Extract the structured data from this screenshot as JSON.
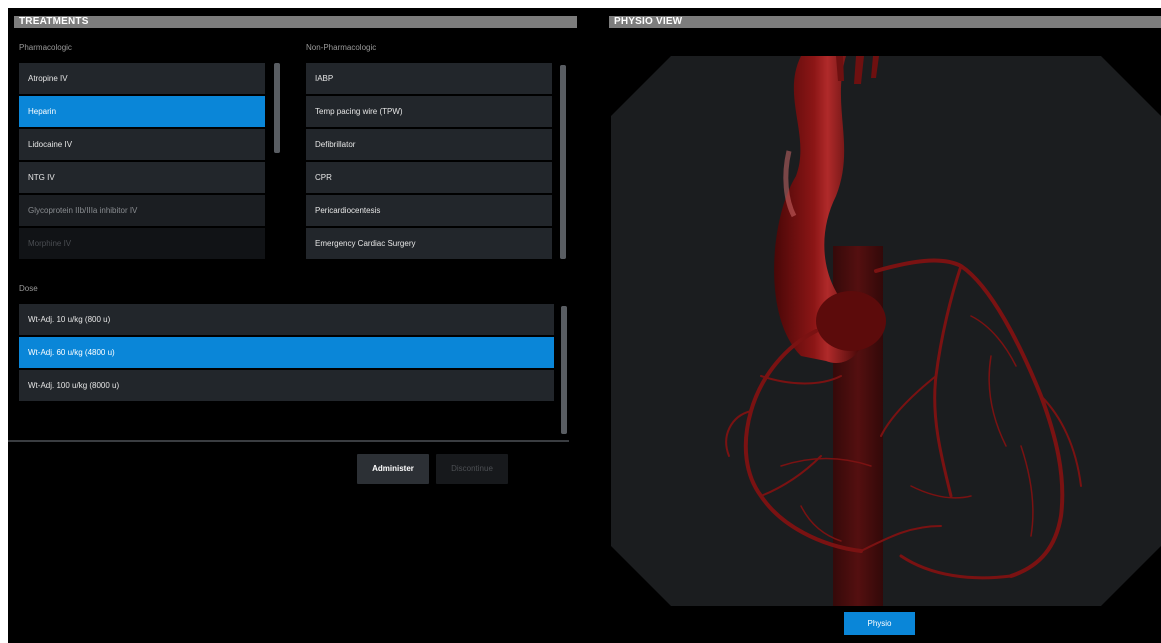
{
  "treatments": {
    "title": "TREATMENTS",
    "pharmacologic_label": "Pharmacologic",
    "non_pharmacologic_label": "Non-Pharmacologic",
    "pharmacologic_items": [
      {
        "label": "Atropine IV",
        "state": "normal"
      },
      {
        "label": "Heparin",
        "state": "selected"
      },
      {
        "label": "Lidocaine IV",
        "state": "normal"
      },
      {
        "label": "NTG IV",
        "state": "normal"
      },
      {
        "label": "Glycoprotein IIb/IIIa inhibitor IV",
        "state": "faded"
      },
      {
        "label": "Morphine IV",
        "state": "faded2"
      }
    ],
    "non_pharmacologic_items": [
      {
        "label": "IABP",
        "state": "normal"
      },
      {
        "label": "Temp pacing wire (TPW)",
        "state": "normal"
      },
      {
        "label": "Defibrillator",
        "state": "normal"
      },
      {
        "label": "CPR",
        "state": "normal"
      },
      {
        "label": "Pericardiocentesis",
        "state": "normal"
      },
      {
        "label": "Emergency Cardiac Surgery",
        "state": "normal"
      }
    ],
    "dose_label": "Dose",
    "dose_items": [
      {
        "label": "Wt-Adj. 10 u/kg (800 u)",
        "state": "normal"
      },
      {
        "label": "Wt-Adj. 60 u/kg (4800 u)",
        "state": "selected"
      },
      {
        "label": "Wt-Adj. 100 u/kg (8000 u)",
        "state": "normal"
      }
    ],
    "administer_label": "Administer",
    "discontinue_label": "Discontinue"
  },
  "physio": {
    "title": "PHYSIO VIEW",
    "button_label": "Physio"
  },
  "colors": {
    "accent": "#0a86d8",
    "header_bar": "#7d7d7d",
    "list_bg": "#22262b",
    "vessel": "#7a1212"
  }
}
